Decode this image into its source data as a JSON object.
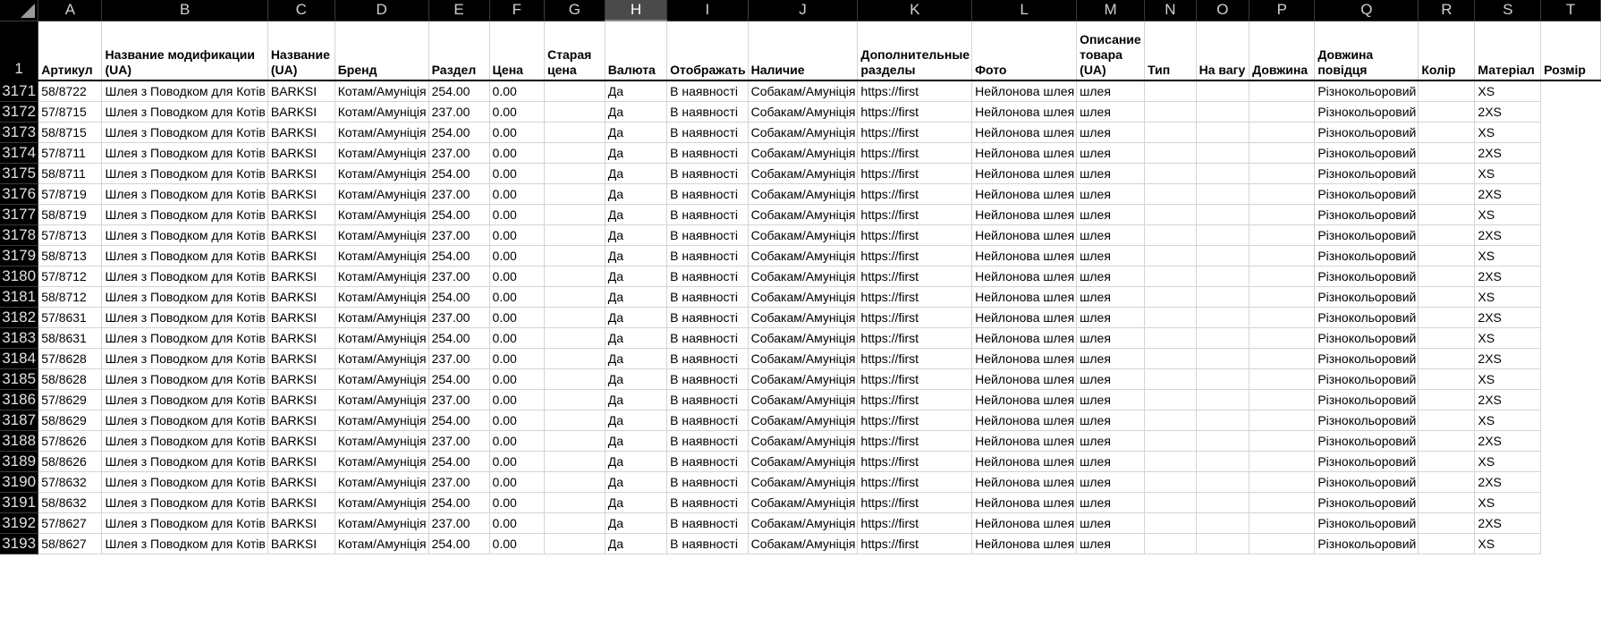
{
  "columns": [
    "A",
    "B",
    "C",
    "D",
    "E",
    "F",
    "G",
    "H",
    "I",
    "J",
    "K",
    "L",
    "M",
    "N",
    "O",
    "P",
    "Q",
    "R",
    "S",
    "T"
  ],
  "selected_column": "H",
  "header_row_number": "1",
  "headers": [
    "Артикул",
    "Название модификации (UA)",
    "Название (UA)",
    "Бренд",
    "Раздел",
    "Цена",
    "Старая цена",
    "Валюта",
    "Отображать",
    "Наличие",
    "Дополнительные разделы",
    "Фото",
    "Описание товара (UA)",
    "Тип",
    "На вагу",
    "Довжина",
    "Довжина повідця",
    "Колір",
    "Матеріал",
    "Розмір"
  ],
  "rows": [
    {
      "num": "3171",
      "cells": [
        "58/8722",
        "Шлея з Поводком для Котів",
        "BARKSI",
        "Котам/Амуніція",
        "254.00",
        "0.00",
        "",
        "Да",
        "В наявності",
        "Собакам/Амуніція",
        "https://first",
        "Нейлонова шлея",
        "шлея",
        "",
        "",
        "",
        "Різнокольоровий",
        "",
        "XS"
      ]
    },
    {
      "num": "3172",
      "cells": [
        "57/8715",
        "Шлея з Поводком для Котів",
        "BARKSI",
        "Котам/Амуніція",
        "237.00",
        "0.00",
        "",
        "Да",
        "В наявності",
        "Собакам/Амуніція",
        "https://first",
        "Нейлонова шлея",
        "шлея",
        "",
        "",
        "",
        "Різнокольоровий",
        "",
        "2XS"
      ]
    },
    {
      "num": "3173",
      "cells": [
        "58/8715",
        "Шлея з Поводком для Котів",
        "BARKSI",
        "Котам/Амуніція",
        "254.00",
        "0.00",
        "",
        "Да",
        "В наявності",
        "Собакам/Амуніція",
        "https://first",
        "Нейлонова шлея",
        "шлея",
        "",
        "",
        "",
        "Різнокольоровий",
        "",
        "XS"
      ]
    },
    {
      "num": "3174",
      "cells": [
        "57/8711",
        "Шлея з Поводком для Котів",
        "BARKSI",
        "Котам/Амуніція",
        "237.00",
        "0.00",
        "",
        "Да",
        "В наявності",
        "Собакам/Амуніція",
        "https://first",
        "Нейлонова шлея",
        "шлея",
        "",
        "",
        "",
        "Різнокольоровий",
        "",
        "2XS"
      ]
    },
    {
      "num": "3175",
      "cells": [
        "58/8711",
        "Шлея з Поводком для Котів",
        "BARKSI",
        "Котам/Амуніція",
        "254.00",
        "0.00",
        "",
        "Да",
        "В наявності",
        "Собакам/Амуніція",
        "https://first",
        "Нейлонова шлея",
        "шлея",
        "",
        "",
        "",
        "Різнокольоровий",
        "",
        "XS"
      ]
    },
    {
      "num": "3176",
      "cells": [
        "57/8719",
        "Шлея з Поводком для Котів",
        "BARKSI",
        "Котам/Амуніція",
        "237.00",
        "0.00",
        "",
        "Да",
        "В наявності",
        "Собакам/Амуніція",
        "https://first",
        "Нейлонова шлея",
        "шлея",
        "",
        "",
        "",
        "Різнокольоровий",
        "",
        "2XS"
      ]
    },
    {
      "num": "3177",
      "cells": [
        "58/8719",
        "Шлея з Поводком для Котів",
        "BARKSI",
        "Котам/Амуніція",
        "254.00",
        "0.00",
        "",
        "Да",
        "В наявності",
        "Собакам/Амуніція",
        "https://first",
        "Нейлонова шлея",
        "шлея",
        "",
        "",
        "",
        "Різнокольоровий",
        "",
        "XS"
      ]
    },
    {
      "num": "3178",
      "cells": [
        "57/8713",
        "Шлея з Поводком для Котів",
        "BARKSI",
        "Котам/Амуніція",
        "237.00",
        "0.00",
        "",
        "Да",
        "В наявності",
        "Собакам/Амуніція",
        "https://first",
        "Нейлонова шлея",
        "шлея",
        "",
        "",
        "",
        "Різнокольоровий",
        "",
        "2XS"
      ]
    },
    {
      "num": "3179",
      "cells": [
        "58/8713",
        "Шлея з Поводком для Котів",
        "BARKSI",
        "Котам/Амуніція",
        "254.00",
        "0.00",
        "",
        "Да",
        "В наявності",
        "Собакам/Амуніція",
        "https://first",
        "Нейлонова шлея",
        "шлея",
        "",
        "",
        "",
        "Різнокольоровий",
        "",
        "XS"
      ]
    },
    {
      "num": "3180",
      "cells": [
        "57/8712",
        "Шлея з Поводком для Котів",
        "BARKSI",
        "Котам/Амуніція",
        "237.00",
        "0.00",
        "",
        "Да",
        "В наявності",
        "Собакам/Амуніція",
        "https://first",
        "Нейлонова шлея",
        "шлея",
        "",
        "",
        "",
        "Різнокольоровий",
        "",
        "2XS"
      ]
    },
    {
      "num": "3181",
      "cells": [
        "58/8712",
        "Шлея з Поводком для Котів",
        "BARKSI",
        "Котам/Амуніція",
        "254.00",
        "0.00",
        "",
        "Да",
        "В наявності",
        "Собакам/Амуніція",
        "https://first",
        "Нейлонова шлея",
        "шлея",
        "",
        "",
        "",
        "Різнокольоровий",
        "",
        "XS"
      ]
    },
    {
      "num": "3182",
      "cells": [
        "57/8631",
        "Шлея з Поводком для Котів",
        "BARKSI",
        "Котам/Амуніція",
        "237.00",
        "0.00",
        "",
        "Да",
        "В наявності",
        "Собакам/Амуніція",
        "https://first",
        "Нейлонова шлея",
        "шлея",
        "",
        "",
        "",
        "Різнокольоровий",
        "",
        "2XS"
      ]
    },
    {
      "num": "3183",
      "cells": [
        "58/8631",
        "Шлея з Поводком для Котів",
        "BARKSI",
        "Котам/Амуніція",
        "254.00",
        "0.00",
        "",
        "Да",
        "В наявності",
        "Собакам/Амуніція",
        "https://first",
        "Нейлонова шлея",
        "шлея",
        "",
        "",
        "",
        "Різнокольоровий",
        "",
        "XS"
      ]
    },
    {
      "num": "3184",
      "cells": [
        "57/8628",
        "Шлея з Поводком для Котів",
        "BARKSI",
        "Котам/Амуніція",
        "237.00",
        "0.00",
        "",
        "Да",
        "В наявності",
        "Собакам/Амуніція",
        "https://first",
        "Нейлонова шлея",
        "шлея",
        "",
        "",
        "",
        "Різнокольоровий",
        "",
        "2XS"
      ]
    },
    {
      "num": "3185",
      "cells": [
        "58/8628",
        "Шлея з Поводком для Котів",
        "BARKSI",
        "Котам/Амуніція",
        "254.00",
        "0.00",
        "",
        "Да",
        "В наявності",
        "Собакам/Амуніція",
        "https://first",
        "Нейлонова шлея",
        "шлея",
        "",
        "",
        "",
        "Різнокольоровий",
        "",
        "XS"
      ]
    },
    {
      "num": "3186",
      "cells": [
        "57/8629",
        "Шлея з Поводком для Котів",
        "BARKSI",
        "Котам/Амуніція",
        "237.00",
        "0.00",
        "",
        "Да",
        "В наявності",
        "Собакам/Амуніція",
        "https://first",
        "Нейлонова шлея",
        "шлея",
        "",
        "",
        "",
        "Різнокольоровий",
        "",
        "2XS"
      ]
    },
    {
      "num": "3187",
      "cells": [
        "58/8629",
        "Шлея з Поводком для Котів",
        "BARKSI",
        "Котам/Амуніція",
        "254.00",
        "0.00",
        "",
        "Да",
        "В наявності",
        "Собакам/Амуніція",
        "https://first",
        "Нейлонова шлея",
        "шлея",
        "",
        "",
        "",
        "Різнокольоровий",
        "",
        "XS"
      ]
    },
    {
      "num": "3188",
      "cells": [
        "57/8626",
        "Шлея з Поводком для Котів",
        "BARKSI",
        "Котам/Амуніція",
        "237.00",
        "0.00",
        "",
        "Да",
        "В наявності",
        "Собакам/Амуніція",
        "https://first",
        "Нейлонова шлея",
        "шлея",
        "",
        "",
        "",
        "Різнокольоровий",
        "",
        "2XS"
      ]
    },
    {
      "num": "3189",
      "cells": [
        "58/8626",
        "Шлея з Поводком для Котів",
        "BARKSI",
        "Котам/Амуніція",
        "254.00",
        "0.00",
        "",
        "Да",
        "В наявності",
        "Собакам/Амуніція",
        "https://first",
        "Нейлонова шлея",
        "шлея",
        "",
        "",
        "",
        "Різнокольоровий",
        "",
        "XS"
      ]
    },
    {
      "num": "3190",
      "cells": [
        "57/8632",
        "Шлея з Поводком для Котів",
        "BARKSI",
        "Котам/Амуніція",
        "237.00",
        "0.00",
        "",
        "Да",
        "В наявності",
        "Собакам/Амуніція",
        "https://first",
        "Нейлонова шлея",
        "шлея",
        "",
        "",
        "",
        "Різнокольоровий",
        "",
        "2XS"
      ]
    },
    {
      "num": "3191",
      "cells": [
        "58/8632",
        "Шлея з Поводком для Котів",
        "BARKSI",
        "Котам/Амуніція",
        "254.00",
        "0.00",
        "",
        "Да",
        "В наявності",
        "Собакам/Амуніція",
        "https://first",
        "Нейлонова шлея",
        "шлея",
        "",
        "",
        "",
        "Різнокольоровий",
        "",
        "XS"
      ]
    },
    {
      "num": "3192",
      "cells": [
        "57/8627",
        "Шлея з Поводком для Котів",
        "BARKSI",
        "Котам/Амуніція",
        "237.00",
        "0.00",
        "",
        "Да",
        "В наявності",
        "Собакам/Амуніція",
        "https://first",
        "Нейлонова шлея",
        "шлея",
        "",
        "",
        "",
        "Різнокольоровий",
        "",
        "2XS"
      ]
    },
    {
      "num": "3193",
      "cells": [
        "58/8627",
        "Шлея з Поводком для Котів",
        "BARKSI",
        "Котам/Амуніція",
        "254.00",
        "0.00",
        "",
        "Да",
        "В наявності",
        "Собакам/Амуніція",
        "https://first",
        "Нейлонова шлея",
        "шлея",
        "",
        "",
        "",
        "Різнокольоровий",
        "",
        "XS"
      ]
    }
  ]
}
